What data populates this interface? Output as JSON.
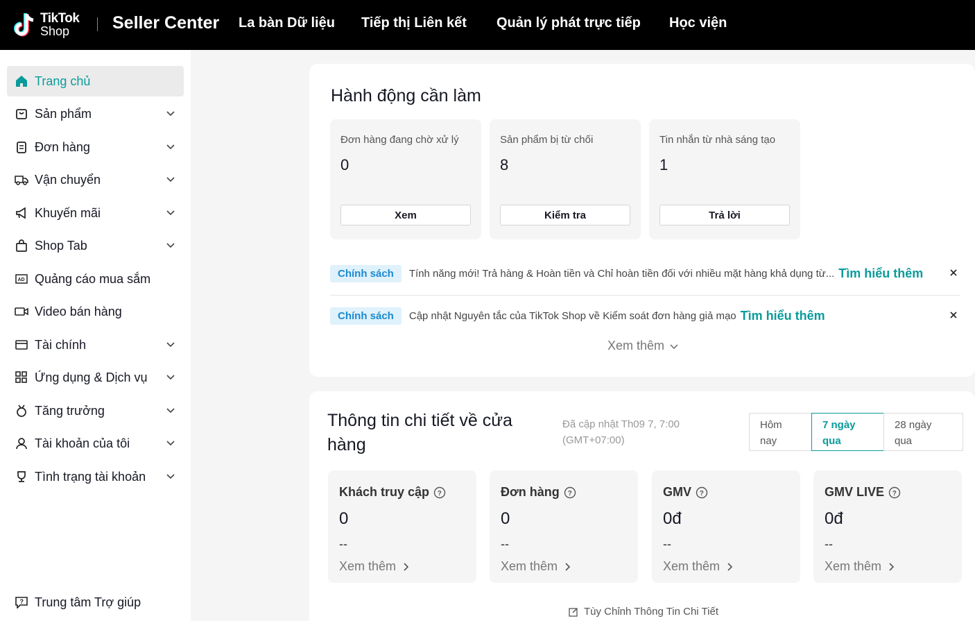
{
  "topbar": {
    "logo_line1": "TikTok",
    "logo_line2": "Shop",
    "title": "Seller Center",
    "nav": [
      "La bàn Dữ liệu",
      "Tiếp thị Liên kết",
      "Quản lý phát trực tiếp",
      "Học viện"
    ]
  },
  "sidebar": {
    "items": [
      {
        "label": "Trang chủ",
        "icon": "home-icon",
        "active": true
      },
      {
        "label": "Sản phẩm",
        "icon": "bag-icon",
        "expandable": true
      },
      {
        "label": "Đơn hàng",
        "icon": "clipboard-icon",
        "expandable": true
      },
      {
        "label": "Vận chuyển",
        "icon": "truck-icon",
        "expandable": true
      },
      {
        "label": "Khuyến mãi",
        "icon": "megaphone-icon",
        "expandable": true
      },
      {
        "label": "Shop Tab",
        "icon": "shop-bag-icon",
        "expandable": true
      },
      {
        "label": "Quảng cáo mua sắm",
        "icon": "ad-icon",
        "expandable": false
      },
      {
        "label": "Video bán hàng",
        "icon": "video-icon",
        "expandable": false
      },
      {
        "label": "Tài chính",
        "icon": "wallet-icon",
        "expandable": true
      },
      {
        "label": "Ứng dụng & Dịch vụ",
        "icon": "apps-icon",
        "expandable": true
      },
      {
        "label": "Tăng trưởng",
        "icon": "medal-icon",
        "expandable": true
      },
      {
        "label": "Tài khoản của tôi",
        "icon": "user-icon",
        "expandable": true
      },
      {
        "label": "Tình trạng tài khoản",
        "icon": "trophy-icon",
        "expandable": true
      }
    ],
    "help": "Trung tâm Trợ giúp"
  },
  "actions": {
    "title": "Hành động cần làm",
    "cards": [
      {
        "label": "Đơn hàng đang chờ xử lý",
        "value": "0",
        "button": "Xem"
      },
      {
        "label": "Sản phẩm bị từ chối",
        "value": "8",
        "button": "Kiểm tra"
      },
      {
        "label": "Tin nhắn từ nhà sáng tạo",
        "value": "1",
        "button": "Trả lời"
      }
    ],
    "notices": [
      {
        "badge": "Chính sách",
        "text": "Tính năng mới! Trả hàng & Hoàn tiền và Chỉ hoàn tiền đối với nhiều mặt hàng khả dụng từ...",
        "link": "Tìm hiểu thêm"
      },
      {
        "badge": "Chính sách",
        "text": "Cập nhật Nguyên tắc của TikTok Shop về Kiểm soát đơn hàng giả mạo",
        "link": "Tìm hiểu thêm"
      }
    ],
    "more": "Xem thêm"
  },
  "insights": {
    "title_line1": "Thông tin chi tiết về cửa",
    "title_line2": "hàng",
    "updated_line1": "Đã cập nhật Th09 7, 7:00",
    "updated_line2": "(GMT+07:00)",
    "ranges": [
      {
        "line1": "Hôm",
        "line2": "nay",
        "active": false
      },
      {
        "line1": "7 ngày",
        "line2": "qua",
        "active": true
      },
      {
        "line1": "28 ngày",
        "line2": "qua",
        "active": false
      }
    ],
    "metrics": [
      {
        "label": "Khách truy cập",
        "value": "0",
        "change": "--",
        "more": "Xem thêm"
      },
      {
        "label": "Đơn hàng",
        "value": "0",
        "change": "--",
        "more": "Xem thêm"
      },
      {
        "label": "GMV",
        "value": "0đ",
        "change": "--",
        "more": "Xem thêm"
      },
      {
        "label": "GMV LIVE",
        "value": "0đ",
        "change": "--",
        "more": "Xem thêm"
      }
    ],
    "customize": "Tùy Chỉnh Thông Tin Chi Tiết"
  },
  "colors": {
    "accent": "#0a9b9b",
    "badge_bg": "#dff1fb",
    "badge_text": "#1b8ad1",
    "topbar": "#000000"
  }
}
